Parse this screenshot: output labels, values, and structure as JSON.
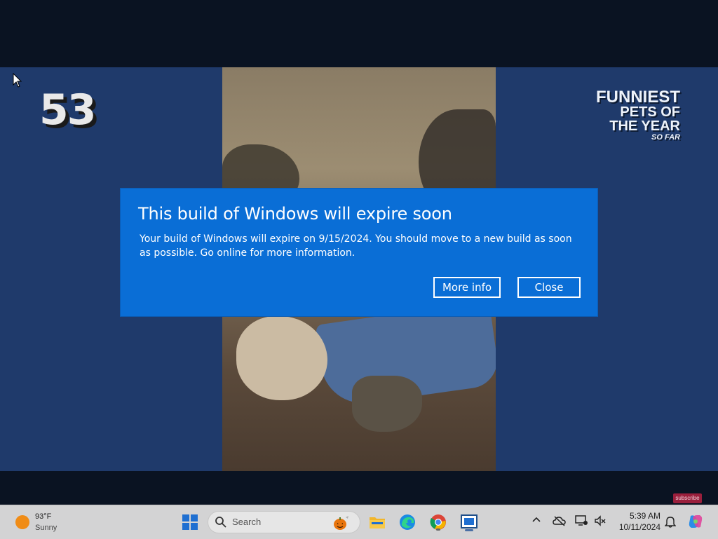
{
  "video": {
    "overlay_number": "53",
    "overlay_title_line1": "FUNNIEST",
    "overlay_title_line2": "PETS OF THE YEAR",
    "overlay_title_line3": "SO FAR",
    "subscribe": "subscribe"
  },
  "dialog": {
    "title": "This build of Windows will expire soon",
    "body": "Your build of Windows will expire on 9/15/2024. You should move to a new build as soon as possible. Go online for more information.",
    "more_info_label": "More info",
    "close_label": "Close",
    "bg_color": "#0a6ed6"
  },
  "taskbar": {
    "weather": {
      "temp": "93°F",
      "condition": "Sunny",
      "icon": "sun-icon"
    },
    "search_placeholder": "Search",
    "apps": [
      {
        "name": "file-explorer",
        "icon": "folder-icon"
      },
      {
        "name": "edge",
        "icon": "edge-icon"
      },
      {
        "name": "chrome",
        "icon": "chrome-icon"
      },
      {
        "name": "active-app",
        "icon": "window-icon"
      }
    ],
    "clock": {
      "time": "5:39 AM",
      "date": "10/11/2024"
    }
  }
}
